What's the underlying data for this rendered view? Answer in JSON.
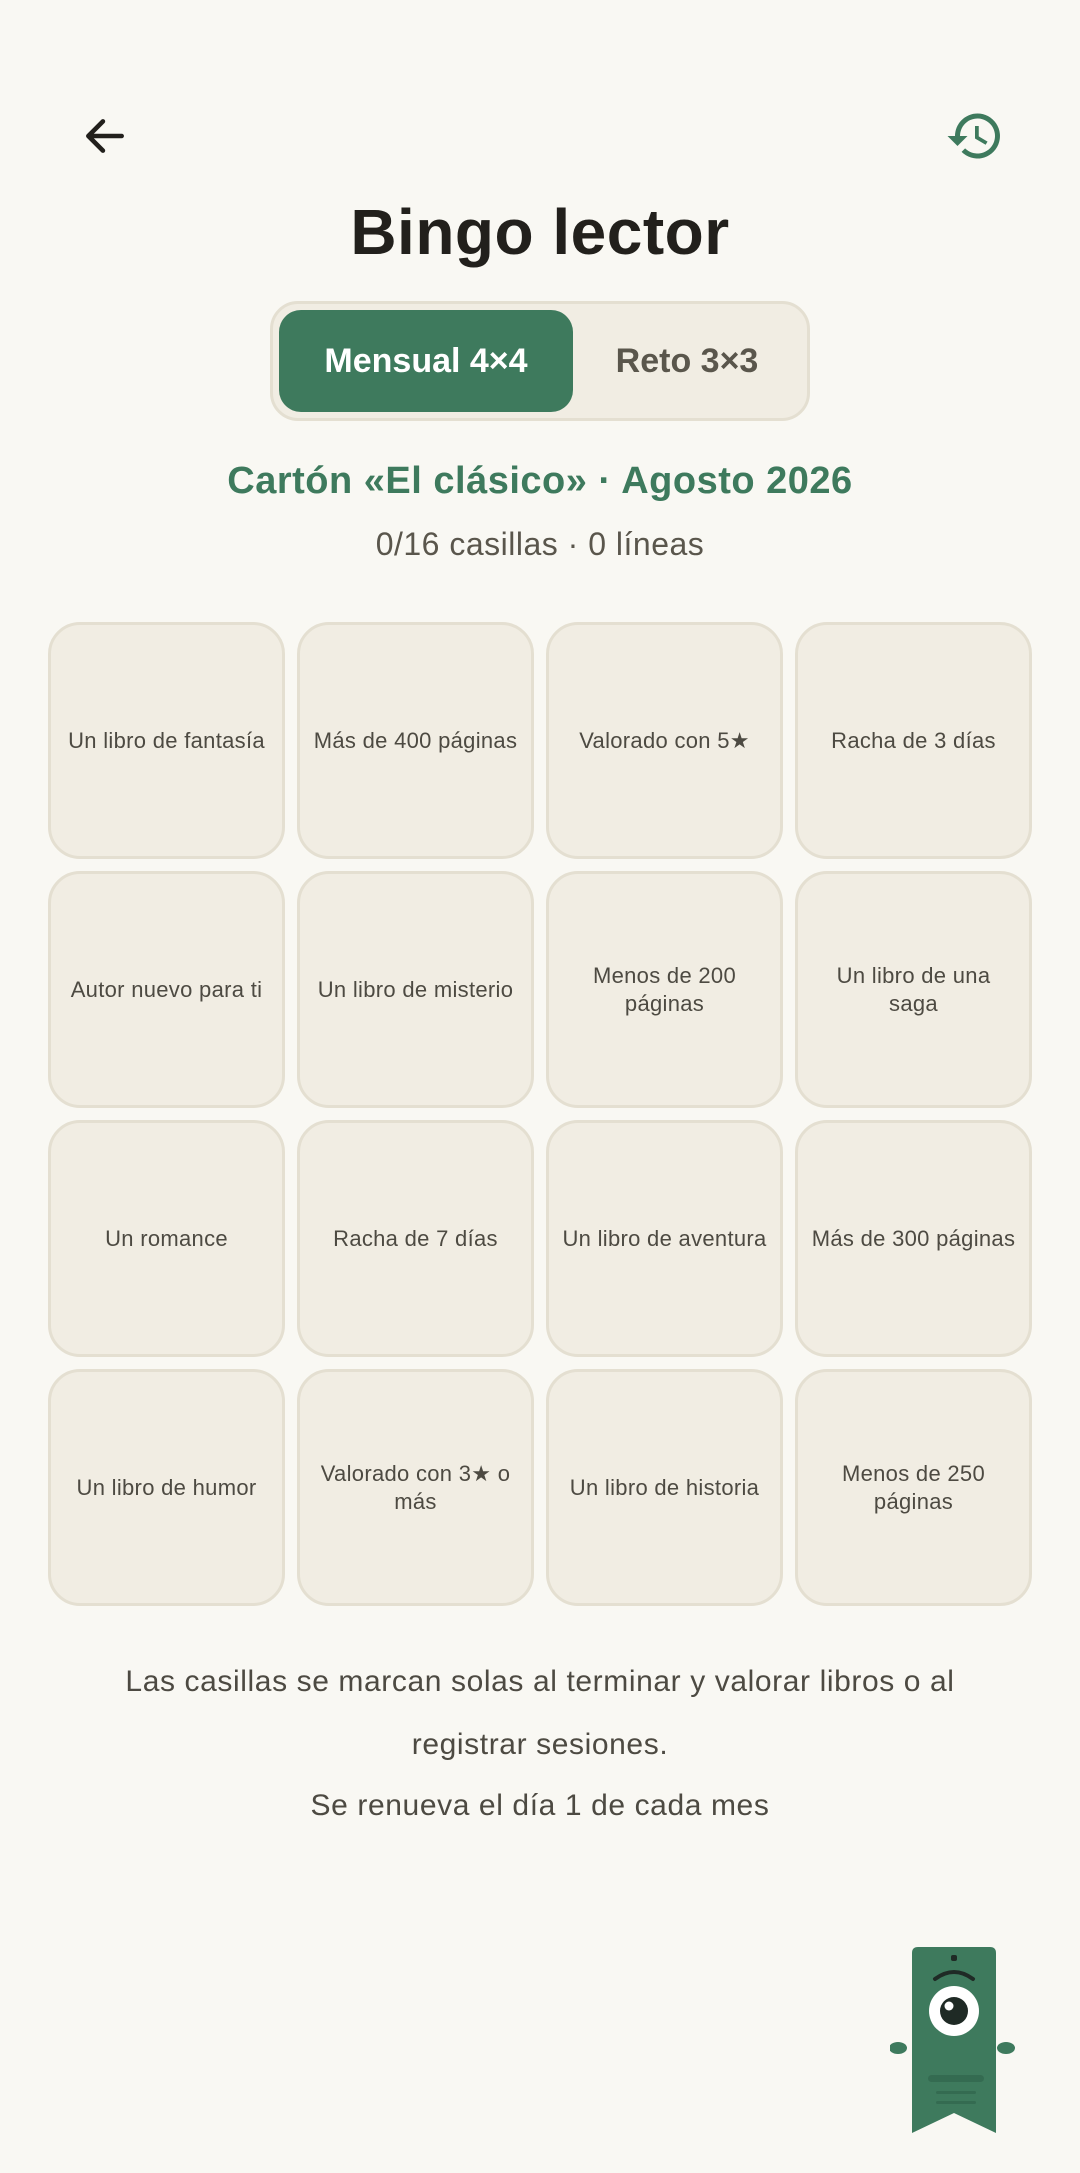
{
  "header": {
    "back_icon": "arrow-left-icon",
    "history_icon": "history-icon",
    "title": "Bingo lector"
  },
  "tabs": [
    {
      "label": "Mensual 4×4",
      "selected": true
    },
    {
      "label": "Reto 3×3",
      "selected": false
    }
  ],
  "card": {
    "title": "Cartón «El clásico» · Agosto 2026",
    "stats": "0/16 casillas · 0 líneas"
  },
  "cells": [
    "Un libro de fantasía",
    "Más de 400 páginas",
    "Valorado con 5★",
    "Racha de 3 días",
    "Autor nuevo para ti",
    "Un libro de misterio",
    "Menos de 200 páginas",
    "Un libro de una saga",
    "Un romance",
    "Racha de 7 días",
    "Un libro de aventura",
    "Más de 300 páginas",
    "Un libro de humor",
    "Valorado con 3★ o más",
    "Un libro de historia",
    "Menos de 250 páginas"
  ],
  "footer": {
    "info": "Las casillas se marcan solas al terminar y valorar libros o al registrar sesiones.",
    "renew": "Se renueva el día 1 de cada mes"
  },
  "colors": {
    "accent": "#3e7a5d",
    "background": "#f9f8f3",
    "cell": "#f1ede3",
    "border": "#e4dfd1"
  },
  "mascot_icon": "bookmark-mascot-icon"
}
